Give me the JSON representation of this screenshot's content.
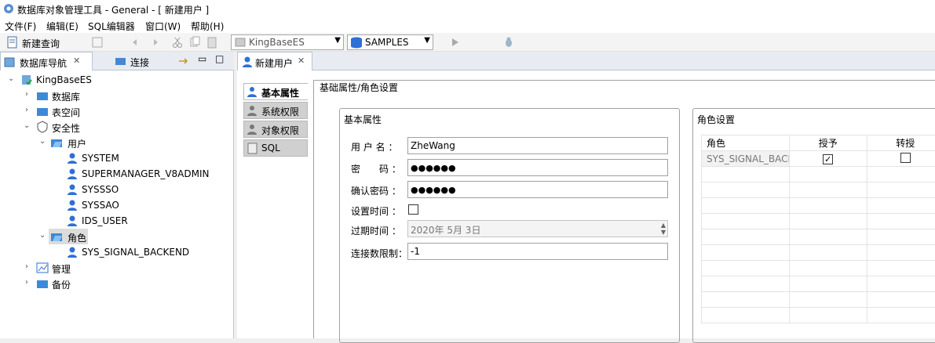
{
  "window": {
    "title": "数据库对象管理工具 - General - [ 新建用户 ]"
  },
  "menu": [
    "文件(F)",
    "编辑(E)",
    "SQL编辑器",
    "窗口(W)",
    "帮助(H)"
  ],
  "toolbar": {
    "new_query": "新建查询",
    "server_combo": "KingBaseES",
    "db_combo": "SAMPLES"
  },
  "left_tabs": {
    "navigator": "数据库导航",
    "connect": "连接"
  },
  "tree": {
    "root": "KingBaseES",
    "nodes": {
      "database": "数据库",
      "tablespace": "表空间",
      "security": "安全性",
      "users": "用户",
      "roles": "角色",
      "manage": "管理",
      "backup": "备份"
    },
    "user_list": [
      "SYSTEM",
      "SUPERMANAGER_V8ADMIN",
      "SYSSSO",
      "SYSSAO",
      "IDS_USER"
    ],
    "role_list": [
      "SYS_SIGNAL_BACKEND"
    ]
  },
  "editor_tab": "新建用户",
  "side_tabs": [
    "基本属性",
    "系统权限",
    "对象权限",
    "SQL"
  ],
  "panel_title": "基础属性/角色设置",
  "basic": {
    "group_title": "基本属性",
    "username_label": "用 户 名 ：",
    "username_value": "ZheWang",
    "password_label": "密　　码 ：",
    "password_value": "●●●●●●",
    "confirm_label": "确认密码 ：",
    "confirm_value": "●●●●●●",
    "settime_label": "设置时间 ：",
    "settime_checked": false,
    "expire_label": "过期时间 ：",
    "expire_value": "2020年  5月  3日",
    "connlimit_label": "连接数限制：",
    "connlimit_value": "-1"
  },
  "roles_panel": {
    "group_title": "角色设置",
    "columns": [
      "角色",
      "授予",
      "转授"
    ],
    "rows": [
      {
        "role": "SYS_SIGNAL_BACK",
        "grant": true,
        "transfer": false
      }
    ]
  }
}
